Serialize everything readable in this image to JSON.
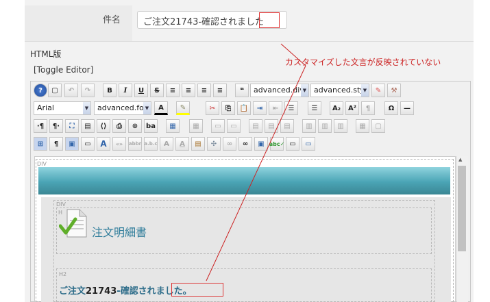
{
  "subject": {
    "label": "件名",
    "value": "ご注文21743-確認されました"
  },
  "html_section": {
    "label": "HTML版",
    "toggle": "[Toggle Editor]"
  },
  "annotation": {
    "text": "カスタマイズした文言が反映されていない",
    "color": "#cc2222"
  },
  "toolbar": {
    "style_select": "advanced.div",
    "style_select2": "advanced.style",
    "font_family": "Arial",
    "font_size": "advanced.font",
    "bold": "B",
    "italic": "I",
    "underline": "U",
    "strike": "S",
    "subscript": "A₂",
    "superscript": "A²",
    "omega": "Ω",
    "quote": "❝",
    "para": "¶",
    "pilcrow_rtl": "·¶"
  },
  "content": {
    "div_tag": "DIV",
    "div_tag2": "DIV",
    "h_tag": "H",
    "h2_tag": "H2",
    "heading": "注文明細書",
    "h2_text_pre": "ご注文",
    "h2_text_num": "21743",
    "h2_text_post": "-確認されました。"
  },
  "colors": {
    "accent": "#2e7c9a",
    "banner": "#4aa4b5",
    "annotation": "#cc2222"
  }
}
